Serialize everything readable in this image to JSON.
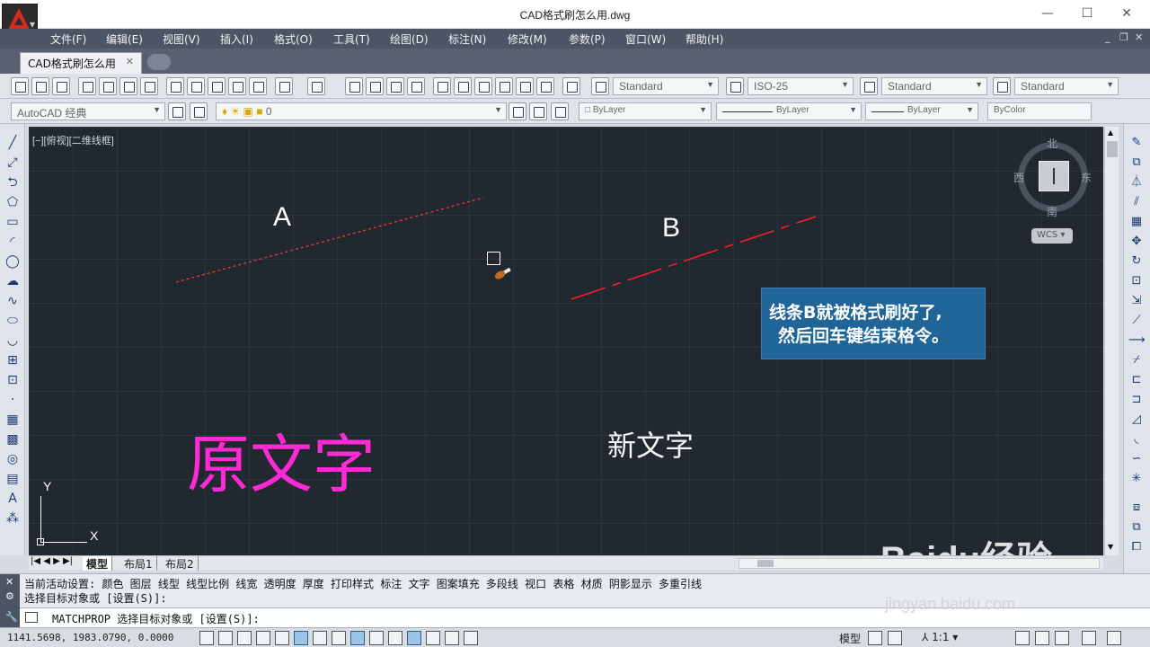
{
  "window": {
    "title": "CAD格式刷怎么用.dwg"
  },
  "menu": [
    "文件(F)",
    "编辑(E)",
    "视图(V)",
    "插入(I)",
    "格式(O)",
    "工具(T)",
    "绘图(D)",
    "标注(N)",
    "修改(M)",
    "参数(P)",
    "窗口(W)",
    "帮助(H)"
  ],
  "doc_tab": {
    "label": "CAD格式刷怎么用",
    "close": "✕"
  },
  "styles": {
    "text_style": "Standard",
    "dim_style": "ISO-25",
    "table_style": "Standard",
    "mleader_style": "Standard"
  },
  "workspace": "AutoCAD 经典",
  "layer": {
    "current": "0"
  },
  "properties": {
    "color": "ByLayer",
    "linetype": "ByLayer",
    "lineweight": "ByLayer",
    "plotstyle": "ByColor"
  },
  "viewport": {
    "label": "[−][俯视][二维线框]",
    "line_a_label": "A",
    "line_b_label": "B",
    "orig_text": "原文字",
    "new_text": "新文字",
    "callout_line1": "线条B就被格式刷好了,",
    "callout_line2": "然后回车键结束格令。",
    "ucs_x": "X",
    "ucs_y": "Y",
    "line_a_color": "#ff3b3b",
    "line_b_color": "#ff1f1f"
  },
  "viewcube": {
    "north": "北",
    "south": "南",
    "east": "东",
    "west": "西",
    "wcs": "WCS"
  },
  "layout_tabs": [
    "模型",
    "布局1",
    "布局2"
  ],
  "command": {
    "history1": "当前活动设置: 颜色 图层 线型 线型比例 线宽 透明度 厚度 打印样式 标注 文字 图案填充 多段线 视口 表格 材质 阴影显示 多重引线",
    "history2": "选择目标对象或 [设置(S)]:",
    "prompt": "MATCHPROP 选择目标对象或 [设置(S)]:"
  },
  "status": {
    "coords": "1141.5698, 1983.0790, 0.0000",
    "model": "模型",
    "scale": "1:1"
  },
  "watermark": {
    "main": "Baidu经验",
    "sub": "jingyan.baidu.com"
  }
}
